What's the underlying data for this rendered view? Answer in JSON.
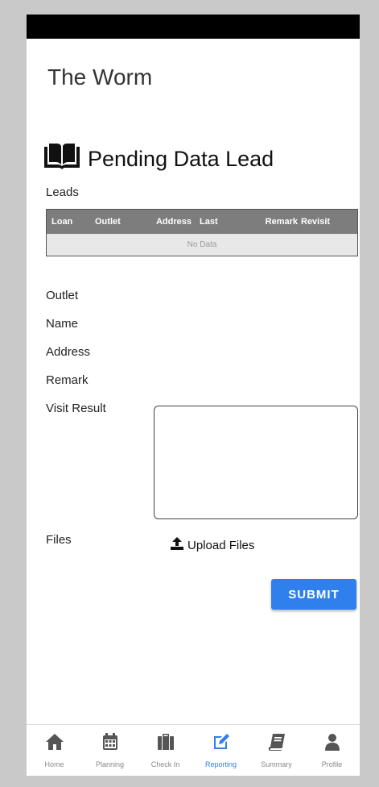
{
  "app": {
    "title": "The Worm"
  },
  "section": {
    "title": "Pending Data Lead",
    "icon": "open-book-icon"
  },
  "leads": {
    "label": "Leads",
    "columns": [
      "Loan",
      "Outlet",
      "Address",
      "Last",
      "Remark",
      "Revisit"
    ],
    "empty_text": "No Data"
  },
  "form": {
    "outlet_label": "Outlet",
    "name_label": "Name",
    "address_label": "Address",
    "remark_label": "Remark",
    "visit_result_label": "Visit Result",
    "visit_result_value": "",
    "files_label": "Files",
    "upload_label": "Upload Files",
    "submit_label": "SUBMIT"
  },
  "nav": {
    "items": [
      {
        "label": "Home",
        "icon": "home-icon",
        "active": false
      },
      {
        "label": "Planning",
        "icon": "calendar-icon",
        "active": false
      },
      {
        "label": "Check In",
        "icon": "suitcase-icon",
        "active": false
      },
      {
        "label": "Reporting",
        "icon": "edit-icon",
        "active": true
      },
      {
        "label": "Summary",
        "icon": "book-icon",
        "active": false
      },
      {
        "label": "Profile",
        "icon": "user-icon",
        "active": false
      }
    ]
  },
  "colors": {
    "accent": "#2f80ed",
    "table_header": "#7d7d7d",
    "inactive_icon": "#555555"
  }
}
